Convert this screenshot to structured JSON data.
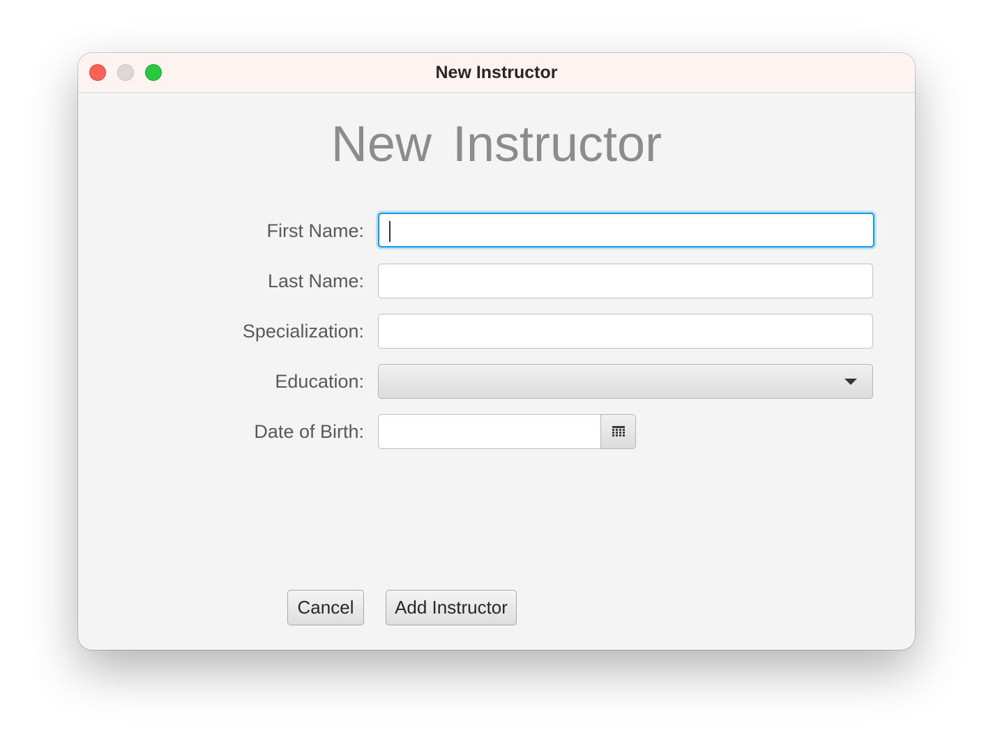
{
  "window": {
    "title": "New Instructor",
    "controls": [
      "close",
      "minimize",
      "zoom"
    ]
  },
  "form": {
    "heading": "New Instructor",
    "fields": [
      {
        "label": "First Name:",
        "value": "",
        "focused": true
      },
      {
        "label": "Last Name:",
        "value": ""
      },
      {
        "label": "Specialization:",
        "value": ""
      },
      {
        "label": "Education:",
        "value": "",
        "type": "dropdown"
      },
      {
        "label": "Date of Birth:",
        "value": "",
        "type": "date-picker",
        "icon": "calendar-icon"
      }
    ]
  },
  "buttons": {
    "cancel": "Cancel",
    "add": "Add Instructor"
  },
  "colors": {
    "titlebar": "#fdf3f1",
    "focus_ring": "#0b9be3",
    "close": "#fe5f57",
    "minimize": "#ddd7d6",
    "zoom": "#28c840"
  }
}
